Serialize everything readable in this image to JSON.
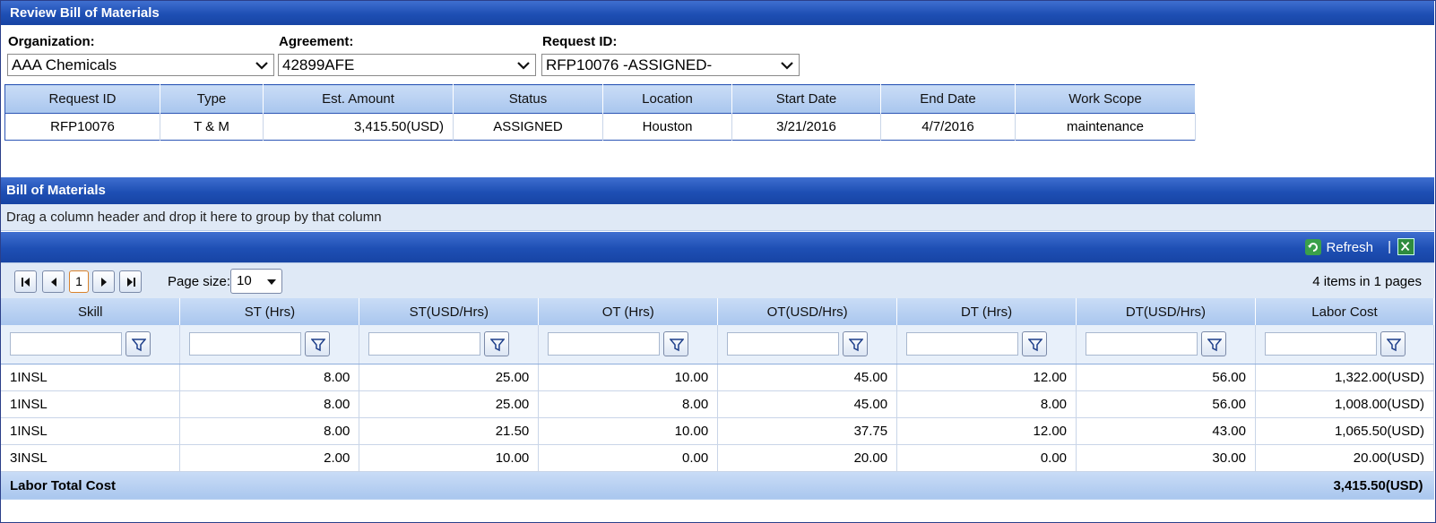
{
  "window": {
    "title": "Review Bill of Materials"
  },
  "filters": {
    "organization": {
      "label": "Organization:",
      "value": "AAA Chemicals"
    },
    "agreement": {
      "label": "Agreement:",
      "value": "42899AFE"
    },
    "request": {
      "label": "Request ID:",
      "value": "RFP10076 -ASSIGNED-"
    }
  },
  "request_table": {
    "headers": [
      "Request ID",
      "Type",
      "Est. Amount",
      "Status",
      "Location",
      "Start Date",
      "End Date",
      "Work Scope"
    ],
    "row": [
      "RFP10076",
      "T & M",
      "3,415.50(USD)",
      "ASSIGNED",
      "Houston",
      "3/21/2016",
      "4/7/2016",
      "maintenance"
    ]
  },
  "bom": {
    "title": "Bill of Materials",
    "group_hint": "Drag a column header and drop it here to group by that column",
    "refresh_label": "Refresh",
    "separator": "|",
    "pager": {
      "first": "⏮",
      "prev": "◀",
      "current_page": "1",
      "next": "▶",
      "last": "⏭",
      "page_size_label": "Page size:",
      "page_size": "10",
      "info": "4 items in 1 pages"
    },
    "columns": [
      "Skill",
      "ST (Hrs)",
      "ST(USD/Hrs)",
      "OT (Hrs)",
      "OT(USD/Hrs)",
      "DT (Hrs)",
      "DT(USD/Hrs)",
      "Labor Cost"
    ],
    "rows": [
      [
        "1INSL",
        "8.00",
        "25.00",
        "10.00",
        "45.00",
        "12.00",
        "56.00",
        "1,322.00(USD)"
      ],
      [
        "1INSL",
        "8.00",
        "25.00",
        "8.00",
        "45.00",
        "8.00",
        "56.00",
        "1,008.00(USD)"
      ],
      [
        "1INSL",
        "8.00",
        "21.50",
        "10.00",
        "37.75",
        "12.00",
        "43.00",
        "1,065.50(USD)"
      ],
      [
        "3INSL",
        "2.00",
        "10.00",
        "0.00",
        "20.00",
        "0.00",
        "30.00",
        "20.00(USD)"
      ]
    ],
    "footer": {
      "label": "Labor Total Cost",
      "total": "3,415.50(USD)"
    }
  },
  "colors": {
    "header_blue": "#1e4fb4",
    "light_blue": "#dfe9f6",
    "accent_orange": "#d9822b"
  }
}
